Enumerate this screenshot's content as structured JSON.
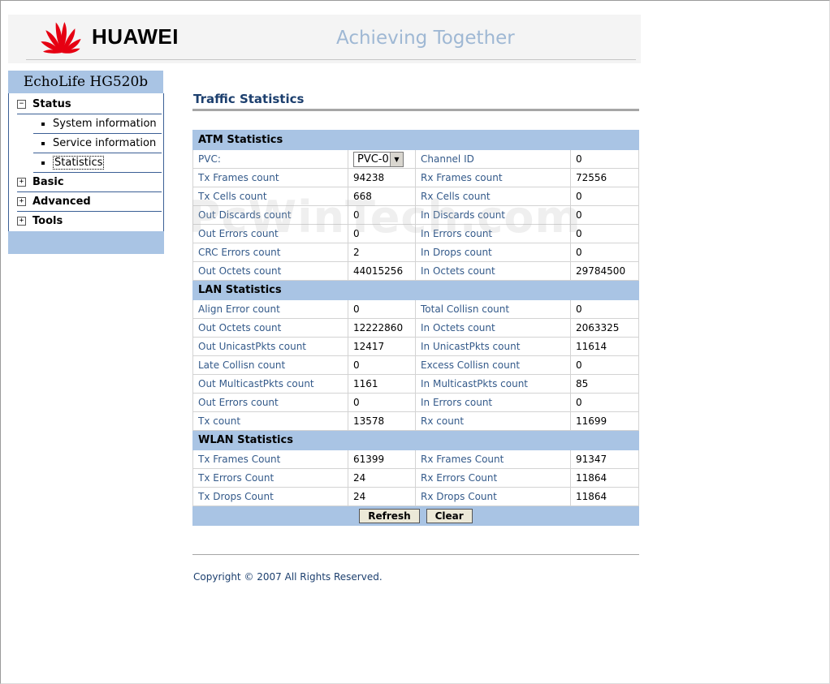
{
  "header": {
    "brand": "HUAWEI",
    "slogan": "Achieving Together"
  },
  "sidebar": {
    "title": "EchoLife HG520b",
    "items": [
      {
        "label": "Status",
        "expander": "−",
        "expanded": true,
        "children": [
          "System information",
          "Service information",
          "Statistics"
        ]
      },
      {
        "label": "Basic",
        "expander": "+"
      },
      {
        "label": "Advanced",
        "expander": "+"
      },
      {
        "label": "Tools",
        "expander": "+"
      }
    ],
    "selected": "Statistics"
  },
  "main": {
    "title": "Traffic Statistics",
    "atm": {
      "heading": "ATM Statistics",
      "pvc_label": "PVC:",
      "pvc_value": "PVC-0",
      "rows": [
        [
          "Channel ID",
          "0"
        ],
        [
          "Tx Frames count",
          "94238",
          "Rx Frames count",
          "72556"
        ],
        [
          "Tx Cells count",
          "668",
          "Rx Cells count",
          "0"
        ],
        [
          "Out Discards count",
          "0",
          "In Discards count",
          "0"
        ],
        [
          "Out Errors count",
          "0",
          "In Errors count",
          "0"
        ],
        [
          "CRC Errors count",
          "2",
          "In Drops count",
          "0"
        ],
        [
          "Out Octets count",
          "44015256",
          "In Octets count",
          "29784500"
        ]
      ]
    },
    "lan": {
      "heading": "LAN Statistics",
      "rows": [
        [
          "Align Error count",
          "0",
          "Total Collisn count",
          "0"
        ],
        [
          "Out Octets count",
          "12222860",
          "In Octets count",
          "2063325"
        ],
        [
          "Out UnicastPkts count",
          "12417",
          "In UnicastPkts count",
          "11614"
        ],
        [
          "Late Collisn count",
          "0",
          "Excess Collisn count",
          "0"
        ],
        [
          "Out MulticastPkts count",
          "1161",
          "In MulticastPkts count",
          "85"
        ],
        [
          "Out Errors count",
          "0",
          "In Errors count",
          "0"
        ],
        [
          "Tx count",
          "13578",
          "Rx count",
          "11699"
        ]
      ]
    },
    "wlan": {
      "heading": "WLAN Statistics",
      "rows": [
        [
          "Tx Frames Count",
          "61399",
          "Rx Frames Count",
          "91347"
        ],
        [
          "Tx Errors Count",
          "24",
          "Rx Errors Count",
          "11864"
        ],
        [
          "Tx Drops Count",
          "24",
          "Rx Drops Count",
          "11864"
        ]
      ]
    },
    "buttons": {
      "refresh": "Refresh",
      "clear": "Clear"
    },
    "copyright": "Copyright © 2007 All Rights Reserved."
  },
  "watermark": "PcWinTech.com",
  "colors": {
    "accent": "#a9c4e4",
    "title": "#1c3f6e",
    "label": "#345a8a",
    "brand_red": "#e60012"
  },
  "icons": {
    "logo": "huawei-petal-logo",
    "dropdown": "chevron-down-icon"
  }
}
